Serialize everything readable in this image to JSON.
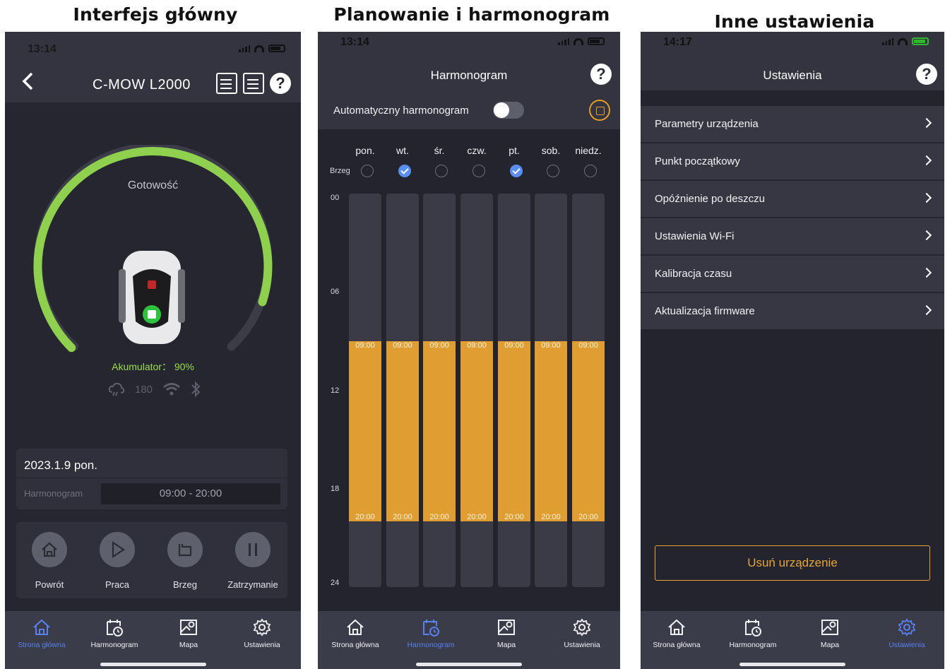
{
  "captions": {
    "main": "Interfejs główny",
    "schedule": "Planowanie i harmonogram",
    "settings": "Inne ustawienia"
  },
  "phone1": {
    "time": "13:14",
    "device_name": "C-MOW  L2000",
    "status": "Gotowość",
    "battery_label": "Akumulator： 90%",
    "battery_percent": 90,
    "rain_delay": "180",
    "date": "2023.1.9 pon.",
    "schedule_label": "Harmonogram",
    "schedule_value": "09:00 - 20:00",
    "actions": [
      "Powrót",
      "Praca",
      "Brzeg",
      "Zatrzymanie"
    ]
  },
  "phone2": {
    "time": "13:14",
    "title": "Harmonogram",
    "auto_label": "Automatyczny harmonogram",
    "auto_enabled": false,
    "days": [
      "pon.",
      "wt.",
      "śr.",
      "czw.",
      "pt.",
      "sob.",
      "niedz."
    ],
    "edge_label": "Brzeg",
    "edge_days": [
      false,
      true,
      false,
      false,
      true,
      false
    ],
    "hours": [
      "00",
      "06",
      "12",
      "18",
      "24"
    ],
    "block_start": "09:00",
    "block_end": "20:00"
  },
  "phone3": {
    "time": "14:17",
    "title": "Ustawienia",
    "items": [
      "Parametry urządzenia",
      "Punkt początkowy",
      "Opóźnienie po deszczu",
      "Ustawienia Wi-Fi",
      "Kalibracja czasu",
      "Aktualizacja firmware"
    ],
    "delete_label": "Usuń urządzenie"
  },
  "tabs": [
    "Strona główna",
    "Harmonogram",
    "Mapa",
    "Ustawienia"
  ],
  "colors": {
    "accent_blue": "#5a80f0",
    "schedule_orange": "#e09d31",
    "battery_green": "#8fd14f",
    "delete_orange": "#e6a43a"
  }
}
